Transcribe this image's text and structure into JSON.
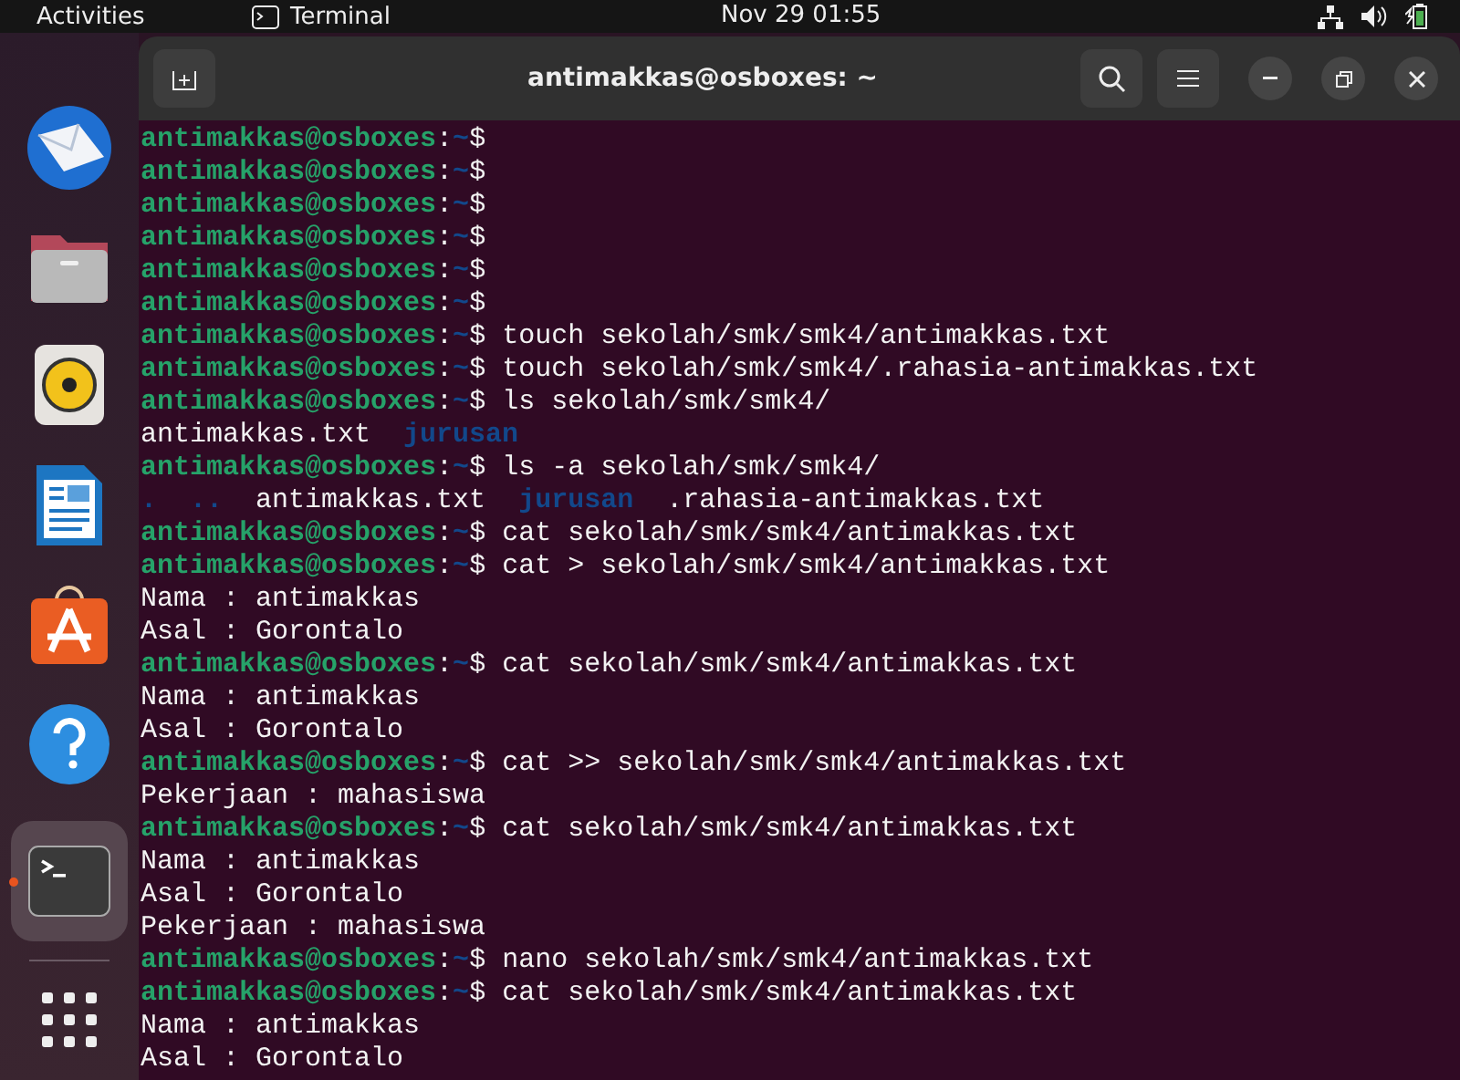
{
  "top_bar": {
    "activities": "Activities",
    "app": "Terminal",
    "clock": "Nov 29  01:55"
  },
  "dock": [
    {
      "kind": "mail",
      "active": false
    },
    {
      "kind": "folder",
      "active": false
    },
    {
      "kind": "speaker",
      "active": false
    },
    {
      "kind": "document",
      "active": false
    },
    {
      "kind": "store",
      "active": false
    },
    {
      "kind": "help",
      "active": false
    },
    {
      "kind": "terminal",
      "active": true
    },
    {
      "kind": "grid",
      "active": false
    }
  ],
  "window": {
    "title": "antimakkas@osboxes: ~"
  },
  "terminal": {
    "lines": [
      {
        "kind": "prompt",
        "user": "antimakkas@osboxes",
        "separator": ":",
        "path": "~",
        "symbol": "$"
      },
      {
        "kind": "prompt",
        "user": "antimakkas@osboxes",
        "separator": ":",
        "path": "~",
        "symbol": "$"
      },
      {
        "kind": "prompt",
        "user": "antimakkas@osboxes",
        "separator": ":",
        "path": "~",
        "symbol": "$"
      },
      {
        "kind": "prompt",
        "user": "antimakkas@osboxes",
        "separator": ":",
        "path": "~",
        "symbol": "$"
      },
      {
        "kind": "prompt",
        "user": "antimakkas@osboxes",
        "separator": ":",
        "path": "~",
        "symbol": "$"
      },
      {
        "kind": "prompt",
        "user": "antimakkas@osboxes",
        "separator": ":",
        "path": "~",
        "symbol": "$"
      },
      {
        "kind": "prompt",
        "user": "antimakkas@osboxes",
        "separator": ":",
        "path": "~",
        "symbol": "$",
        "command": "touch sekolah/smk/smk4/antimakkas.txt"
      },
      {
        "kind": "prompt",
        "user": "antimakkas@osboxes",
        "separator": ":",
        "path": "~",
        "symbol": "$",
        "command": "touch sekolah/smk/smk4/.rahasia-antimakkas.txt"
      },
      {
        "kind": "prompt",
        "user": "antimakkas@osboxes",
        "separator": ":",
        "path": "~",
        "symbol": "$",
        "command": "ls sekolah/smk/smk4/"
      },
      {
        "kind": "listing",
        "entries": [
          {
            "text": "antimakkas.txt",
            "kind": "file"
          },
          {
            "text": "jurusan",
            "kind": "dir"
          }
        ]
      },
      {
        "kind": "prompt",
        "user": "antimakkas@osboxes",
        "separator": ":",
        "path": "~",
        "symbol": "$",
        "command": "ls -a sekolah/smk/smk4/"
      },
      {
        "kind": "listing",
        "entries": [
          {
            "text": ".",
            "kind": "dir"
          },
          {
            "text": "..",
            "kind": "dir"
          },
          {
            "text": "antimakkas.txt",
            "kind": "file"
          },
          {
            "text": "jurusan",
            "kind": "dir"
          },
          {
            "text": ".rahasia-antimakkas.txt",
            "kind": "file"
          }
        ]
      },
      {
        "kind": "prompt",
        "user": "antimakkas@osboxes",
        "separator": ":",
        "path": "~",
        "symbol": "$",
        "command": "cat sekolah/smk/smk4/antimakkas.txt"
      },
      {
        "kind": "prompt",
        "user": "antimakkas@osboxes",
        "separator": ":",
        "path": "~",
        "symbol": "$",
        "command": "cat > sekolah/smk/smk4/antimakkas.txt"
      },
      {
        "kind": "output",
        "text": "Nama : antimakkas"
      },
      {
        "kind": "output",
        "text": "Asal : Gorontalo"
      },
      {
        "kind": "prompt",
        "user": "antimakkas@osboxes",
        "separator": ":",
        "path": "~",
        "symbol": "$",
        "command": "cat sekolah/smk/smk4/antimakkas.txt"
      },
      {
        "kind": "output",
        "text": "Nama : antimakkas"
      },
      {
        "kind": "output",
        "text": "Asal : Gorontalo"
      },
      {
        "kind": "prompt",
        "user": "antimakkas@osboxes",
        "separator": ":",
        "path": "~",
        "symbol": "$",
        "command": "cat >> sekolah/smk/smk4/antimakkas.txt"
      },
      {
        "kind": "output",
        "text": "Pekerjaan : mahasiswa"
      },
      {
        "kind": "prompt",
        "user": "antimakkas@osboxes",
        "separator": ":",
        "path": "~",
        "symbol": "$",
        "command": "cat sekolah/smk/smk4/antimakkas.txt"
      },
      {
        "kind": "output",
        "text": "Nama : antimakkas"
      },
      {
        "kind": "output",
        "text": "Asal : Gorontalo"
      },
      {
        "kind": "output",
        "text": "Pekerjaan : mahasiswa"
      },
      {
        "kind": "prompt",
        "user": "antimakkas@osboxes",
        "separator": ":",
        "path": "~",
        "symbol": "$",
        "command": "nano sekolah/smk/smk4/antimakkas.txt"
      },
      {
        "kind": "prompt",
        "user": "antimakkas@osboxes",
        "separator": ":",
        "path": "~",
        "symbol": "$",
        "command": "cat sekolah/smk/smk4/antimakkas.txt"
      },
      {
        "kind": "output",
        "text": "Nama : antimakkas"
      },
      {
        "kind": "output",
        "text": "Asal : Gorontalo"
      }
    ]
  }
}
